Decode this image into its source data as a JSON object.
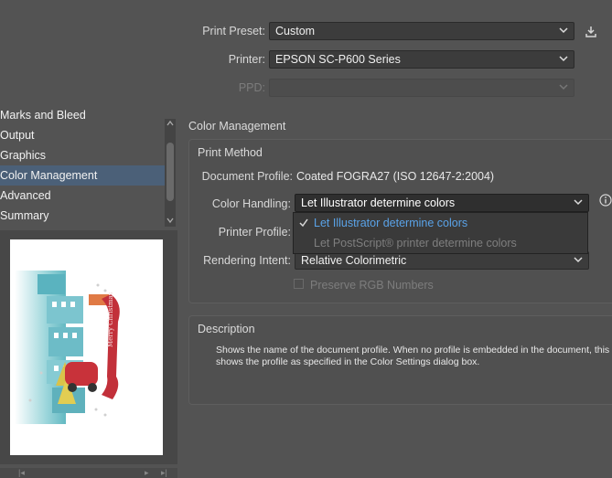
{
  "header": {
    "print_preset_label": "Print Preset:",
    "print_preset_value": "Custom",
    "printer_label": "Printer:",
    "printer_value": "EPSON SC-P600 Series",
    "ppd_label": "PPD:",
    "ppd_value": ""
  },
  "sidebar": {
    "items": [
      {
        "label": "Marks and Bleed"
      },
      {
        "label": "Output"
      },
      {
        "label": "Graphics"
      },
      {
        "label": "Color Management"
      },
      {
        "label": "Advanced"
      },
      {
        "label": "Summary"
      }
    ],
    "selected": "Color Management"
  },
  "color_management": {
    "title": "Color Management",
    "print_method_title": "Print Method",
    "document_profile_label": "Document Profile:",
    "document_profile_value": "Coated FOGRA27 (ISO 12647-2:2004)",
    "color_handling_label": "Color Handling:",
    "color_handling_value": "Let Illustrator determine colors",
    "color_handling_options": [
      {
        "label": "Let Illustrator determine colors",
        "checked": true
      },
      {
        "label": "Let PostScript® printer determine colors",
        "checked": false
      }
    ],
    "printer_profile_label": "Printer Profile:",
    "rendering_intent_label": "Rendering Intent:",
    "rendering_intent_value": "Relative Colorimetric",
    "preserve_rgb_label": "Preserve RGB Numbers"
  },
  "description": {
    "title": "Description",
    "text": "Shows the name of the document profile. When no profile is embedded in the document, this shows the profile as specified in the Color Settings dialog box."
  },
  "preview": {
    "banner_text": "Merry Christmas"
  },
  "colors": {
    "background": "#535353",
    "selected_item": "#4b6078",
    "dropdown_accent": "#5aa3e8"
  }
}
